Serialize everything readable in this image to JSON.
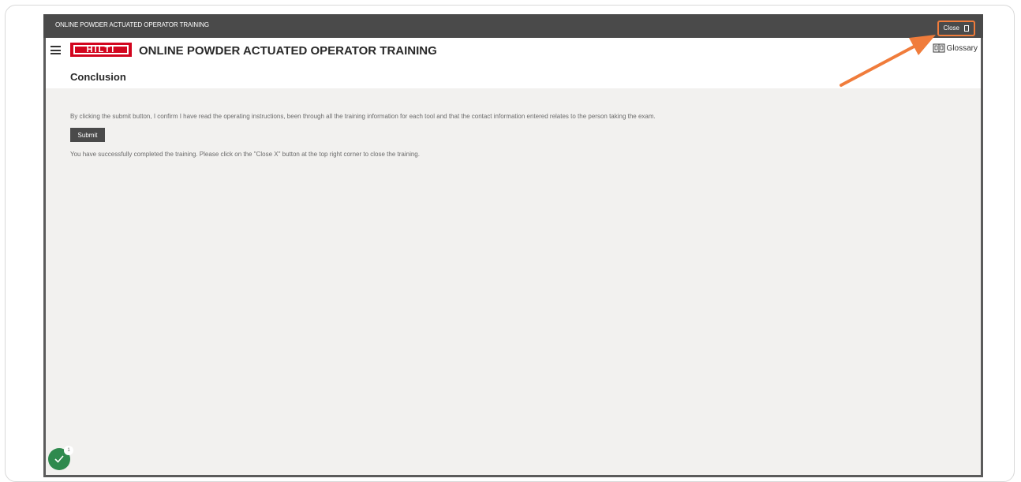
{
  "window": {
    "title": "ONLINE POWDER ACTUATED OPERATOR TRAINING",
    "close_label": "Close"
  },
  "header": {
    "logo_text": "HILTI",
    "course_title": "ONLINE POWDER ACTUATED OPERATOR TRAINING",
    "glossary_label": "Glossary"
  },
  "main": {
    "page_title": "Conclusion",
    "confirm_text": "By clicking the submit button, I confirm I have read the operating instructions, been through all the training information for each tool and that the contact information entered relates to the person taking the exam.",
    "submit_label": "Submit",
    "success_text": "You have successfully completed the training. Please click on the \"Close X\" button at the top right corner to close the training."
  },
  "progress_badge": {
    "count": "1"
  },
  "colors": {
    "accent": "#f07c3b",
    "brand": "#d2051e",
    "badge": "#2f8a4e"
  },
  "icons": [
    "hamburger-menu-icon",
    "book-icon",
    "checkmark-icon",
    "close-icon",
    "arrow-annotation"
  ]
}
